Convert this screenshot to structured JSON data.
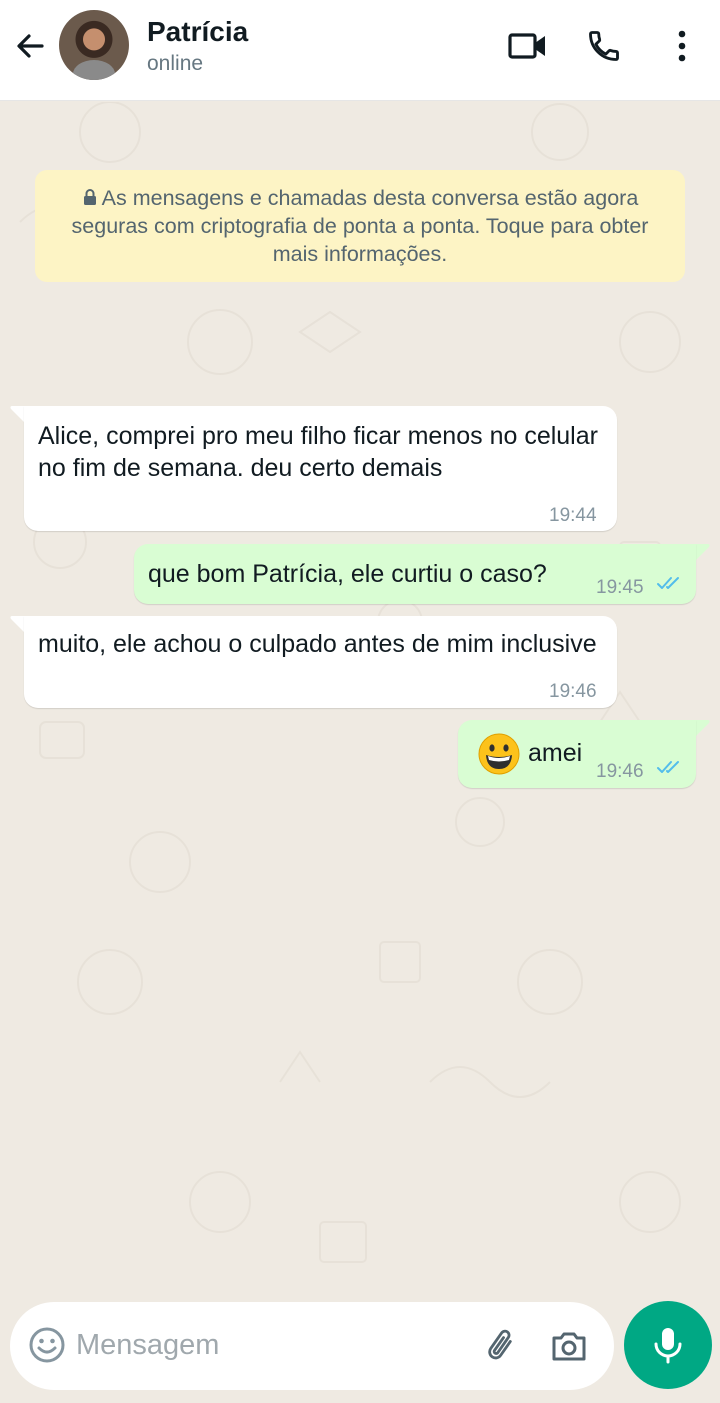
{
  "header": {
    "back_icon": "arrow-left-icon",
    "contact_name": "Patrícia",
    "status": "online",
    "icons": [
      "video-call-icon",
      "phone-icon",
      "more-vertical-icon"
    ]
  },
  "encryption_notice": {
    "icon": "lock-icon",
    "text": "As mensagens e chamadas desta conversa estão agora seguras com criptografia de ponta a ponta. Toque para obter mais informações."
  },
  "messages": [
    {
      "direction": "incoming",
      "text": "Alice, comprei pro meu filho ficar menos no celular no fim de semana. deu certo demais",
      "time": "19:44"
    },
    {
      "direction": "outgoing",
      "text": "que bom Patrícia, ele curtiu o caso?",
      "time": "19:45",
      "status": "read"
    },
    {
      "direction": "incoming",
      "text": "muito, ele achou o culpado antes de mim inclusive",
      "time": "19:46"
    },
    {
      "direction": "outgoing",
      "emoji": "grinning-face-emoji",
      "text": "amei",
      "time": "19:46",
      "status": "read"
    }
  ],
  "composer": {
    "placeholder": "Mensagem",
    "icons": [
      "emoji-icon",
      "paperclip-icon",
      "camera-icon",
      "microphone-icon"
    ]
  },
  "colors": {
    "outgoing_bubble": "#d9fdd3",
    "incoming_bubble": "#ffffff",
    "chat_background": "#efeae2",
    "encryption_banner": "#fdf4c5",
    "accent": "#00a884",
    "read_ticks": "#53bdeb"
  }
}
